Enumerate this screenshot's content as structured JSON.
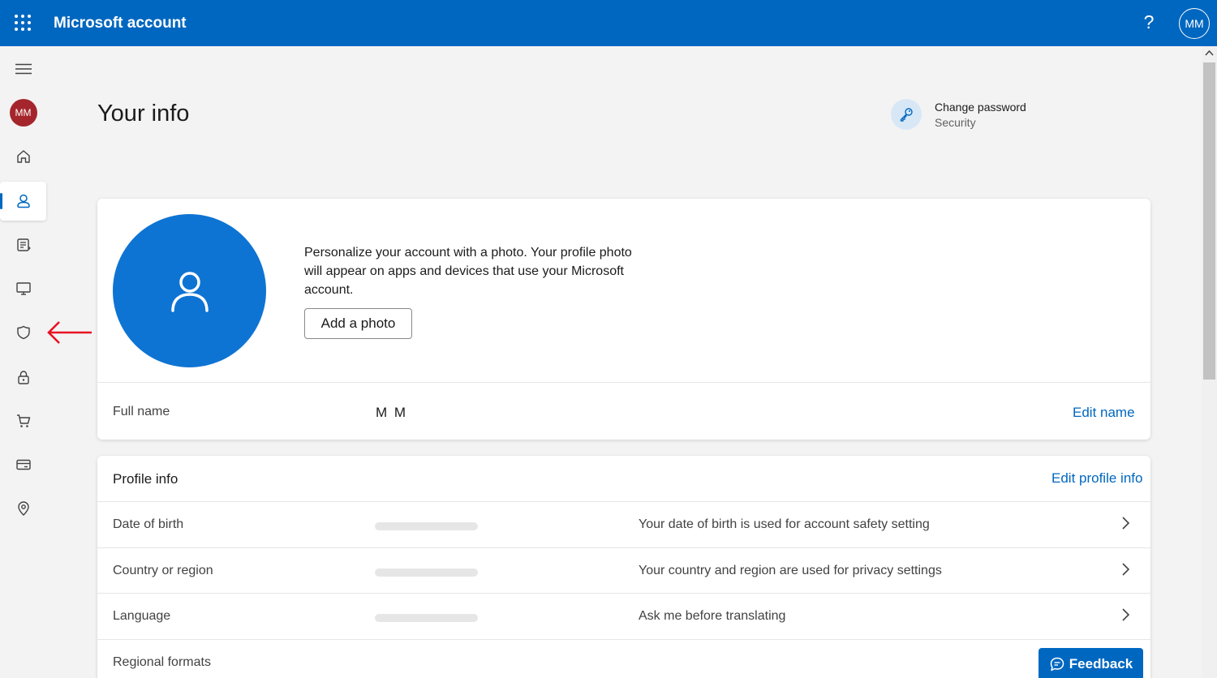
{
  "header": {
    "app_title": "Microsoft account",
    "help_label": "?",
    "user_initials": "MM"
  },
  "sidebar": {
    "user_initials": "MM",
    "items": [
      {
        "name": "menu",
        "icon": "hamburger-icon"
      },
      {
        "name": "avatar",
        "icon": "avatar"
      },
      {
        "name": "home",
        "icon": "home-icon"
      },
      {
        "name": "your-info",
        "icon": "person-icon",
        "active": true
      },
      {
        "name": "subscriptions",
        "icon": "document-list-icon"
      },
      {
        "name": "devices",
        "icon": "monitor-icon"
      },
      {
        "name": "privacy",
        "icon": "shield-icon"
      },
      {
        "name": "security",
        "icon": "lock-icon"
      },
      {
        "name": "order-history",
        "icon": "cart-icon"
      },
      {
        "name": "payment",
        "icon": "card-icon"
      },
      {
        "name": "addresses",
        "icon": "location-pin-icon"
      }
    ]
  },
  "annotation": {
    "icon": "red-arrow-icon",
    "color": "#e81123"
  },
  "page": {
    "title": "Your info",
    "change_password": {
      "label": "Change password",
      "sublabel": "Security",
      "icon": "key-icon"
    }
  },
  "photo_card": {
    "description": "Personalize your account with a photo. Your profile photo will appear on apps and devices that use your Microsoft account.",
    "add_photo_label": "Add a photo",
    "full_name_label": "Full name",
    "full_name_value": "M M",
    "edit_name_label": "Edit name"
  },
  "profile_info": {
    "title": "Profile info",
    "edit_label": "Edit profile info",
    "rows": [
      {
        "label": "Date of birth",
        "description": "Your date of birth is used for account safety setting"
      },
      {
        "label": "Country or region",
        "description": "Your country and region are used for privacy settings"
      },
      {
        "label": "Language",
        "description": "Ask me before translating"
      },
      {
        "label": "Regional formats",
        "description": ""
      }
    ]
  },
  "feedback": {
    "label": "Feedback"
  },
  "colors": {
    "brand": "#0067c0",
    "avatar": "#a4262c",
    "photo_circle": "#0e74d3"
  }
}
